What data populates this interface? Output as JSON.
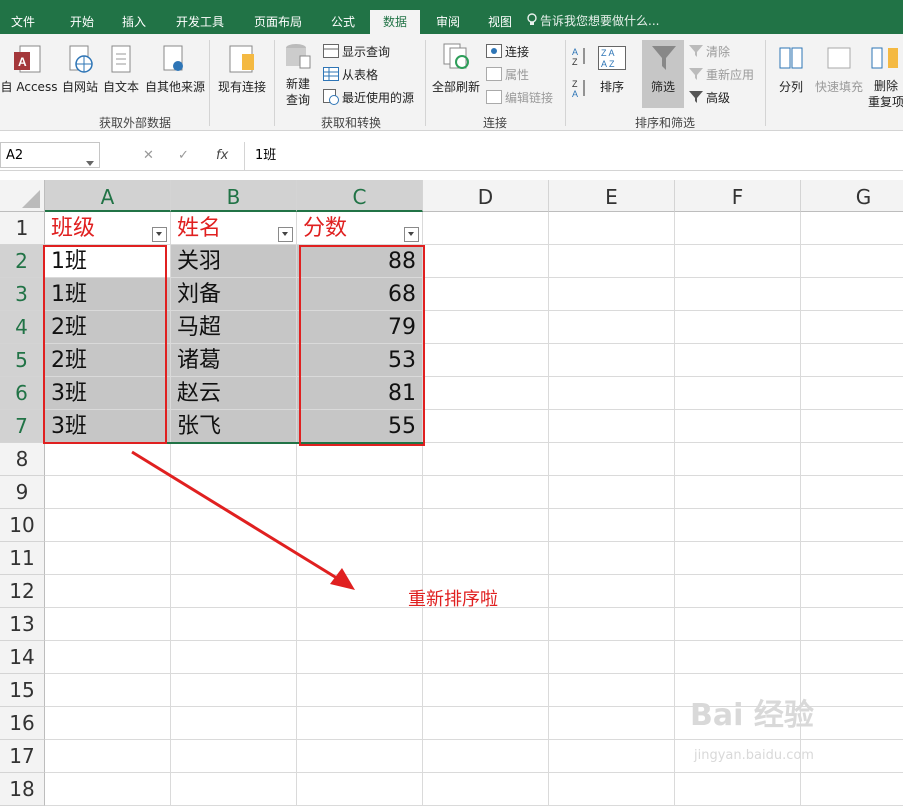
{
  "tabs": [
    "文件",
    "开始",
    "插入",
    "开发工具",
    "页面布局",
    "公式",
    "数据",
    "审阅",
    "视图"
  ],
  "active_tab": "数据",
  "tell_me": "告诉我您想要做什么...",
  "ribbon": {
    "get_external": {
      "access": "自 Access",
      "web": "自网站",
      "text": "自文本",
      "other": "自其他来源",
      "existing": "现有连接",
      "label": "获取外部数据"
    },
    "transform": {
      "new_query": "新建",
      "new_query2": "查询",
      "show_queries": "显示查询",
      "from_table": "从表格",
      "recent": "最近使用的源",
      "label": "获取和转换"
    },
    "connections": {
      "refresh_all": "全部刷新",
      "connections": "连接",
      "properties": "属性",
      "edit_links": "编辑链接",
      "label": "连接"
    },
    "sort_filter": {
      "sort": "排序",
      "filter": "筛选",
      "clear": "清除",
      "reapply": "重新应用",
      "advanced": "高级",
      "label": "排序和筛选"
    },
    "tools": {
      "split": "分列",
      "flash_fill": "快速填充",
      "remove_dup": "删除",
      "remove_dup2": "重复项"
    }
  },
  "name_box": "A2",
  "formula_value": "1班",
  "columns": [
    "A",
    "B",
    "C",
    "D",
    "E",
    "F",
    "G"
  ],
  "rows": [
    "1",
    "2",
    "3",
    "4",
    "5",
    "6",
    "7",
    "8",
    "9",
    "10",
    "11",
    "12",
    "13",
    "14",
    "15",
    "16",
    "17",
    "18"
  ],
  "headers": [
    "班级",
    "姓名",
    "分数"
  ],
  "data": [
    [
      "1班",
      "关羽",
      "88"
    ],
    [
      "1班",
      "刘备",
      "68"
    ],
    [
      "2班",
      "马超",
      "79"
    ],
    [
      "2班",
      "诸葛",
      "53"
    ],
    [
      "3班",
      "赵云",
      "81"
    ],
    [
      "3班",
      "张飞",
      "55"
    ]
  ],
  "annotation": "重新排序啦",
  "watermark": "Bai 经验",
  "watermark_url": "jingyan.baidu.com",
  "colors": {
    "accent": "#217346",
    "red": "#e02020",
    "selection_gray": "#c6c6c6"
  }
}
